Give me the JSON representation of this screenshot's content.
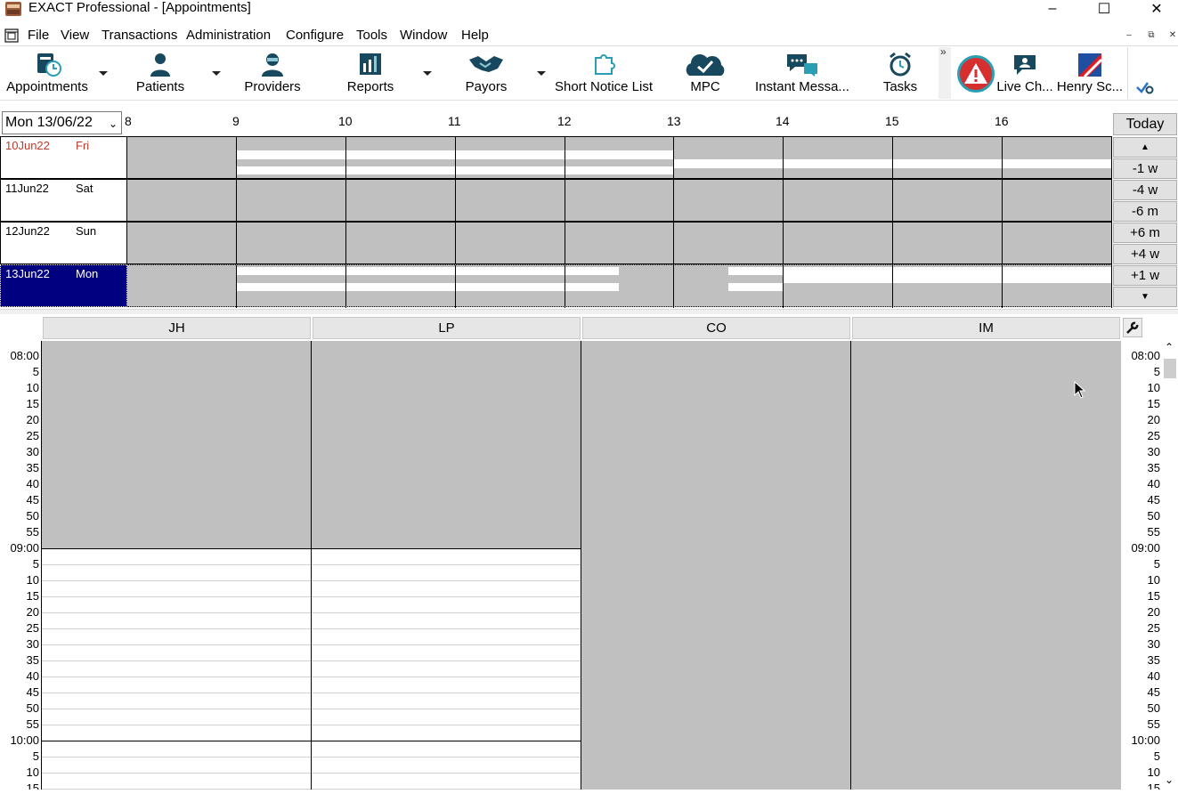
{
  "window": {
    "title": "EXACT Professional - [Appointments]"
  },
  "menu": [
    "File",
    "View",
    "Transactions",
    "Administration",
    "Configure",
    "Tools",
    "Window",
    "Help"
  ],
  "toolbar": {
    "buttons": [
      {
        "label": "Appointments",
        "icon": "appointments-icon"
      },
      {
        "label": "Patients",
        "icon": "patient-icon"
      },
      {
        "label": "Providers",
        "icon": "provider-icon"
      },
      {
        "label": "Reports",
        "icon": "reports-icon"
      },
      {
        "label": "Payors",
        "icon": "handshake-icon"
      },
      {
        "label": "Short Notice List",
        "icon": "puzzle-icon"
      },
      {
        "label": "MPC",
        "icon": "cloud-check-icon"
      },
      {
        "label": "Instant Messa...",
        "icon": "chat-icon"
      },
      {
        "label": "Tasks",
        "icon": "alarm-clock-icon"
      }
    ],
    "overflow": "»",
    "extra": [
      {
        "label": "Live Ch...",
        "icon": "live-chat-icon"
      },
      {
        "label": "Henry Sc...",
        "icon": "henry-schein-icon"
      }
    ]
  },
  "planner": {
    "selected_date": "Mon 13/06/22",
    "hours": [
      "8",
      "9",
      "10",
      "11",
      "12",
      "13",
      "14",
      "15",
      "16"
    ],
    "days": [
      {
        "date": "10Jun22",
        "weekday": "Fri",
        "color": "#c0392b"
      },
      {
        "date": "11Jun22",
        "weekday": "Sat",
        "color": "#000000"
      },
      {
        "date": "12Jun22",
        "weekday": "Sun",
        "color": "#000000"
      },
      {
        "date": "13Jun22",
        "weekday": "Mon",
        "color": "#ffffff"
      }
    ],
    "nav": [
      "Today",
      "▲",
      "-1 w",
      "-4 w",
      "-6 m",
      "+6 m",
      "+4 w",
      "+1 w",
      "▼"
    ]
  },
  "dayview": {
    "providers": [
      "JH",
      "LP",
      "CO",
      "IM"
    ],
    "times": [
      "08:00",
      "5",
      "10",
      "15",
      "20",
      "25",
      "30",
      "35",
      "40",
      "45",
      "50",
      "55",
      "09:00",
      "5",
      "10",
      "15",
      "20",
      "25",
      "30",
      "35",
      "40",
      "45",
      "50",
      "55",
      "10:00",
      "5",
      "10",
      "15"
    ]
  },
  "colors": {
    "selected_day_bg": "#000080",
    "unavailable": "#c0c0c0",
    "alert_red": "#d62f2f",
    "teal_icon": "#2a9fb3"
  }
}
